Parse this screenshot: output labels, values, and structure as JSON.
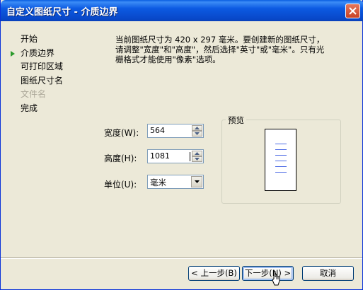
{
  "window": {
    "title": "自定义图纸尺寸 - 介质边界"
  },
  "nav": {
    "items": [
      {
        "label": "开始",
        "current": false,
        "disabled": false
      },
      {
        "label": "介质边界",
        "current": true,
        "disabled": false
      },
      {
        "label": "可打印区域",
        "current": false,
        "disabled": false
      },
      {
        "label": "图纸尺寸名",
        "current": false,
        "disabled": false
      },
      {
        "label": "文件名",
        "current": false,
        "disabled": true
      },
      {
        "label": "完成",
        "current": false,
        "disabled": false
      }
    ]
  },
  "description": {
    "line1": "当前图纸尺寸为 420 x 297 毫米。要创建新的图纸尺寸，",
    "line2": "请调整\"宽度\"和\"高度\"，然后选择\"英寸\"或\"毫米\"。只有光",
    "line3": "栅格式才能使用\"像素\"选项。"
  },
  "form": {
    "width_label": "宽度(W):",
    "width_value": "564",
    "height_label": "高度(H):",
    "height_value": "1081",
    "unit_label": "单位(U):",
    "unit_value": "毫米"
  },
  "preview": {
    "label": "预览"
  },
  "buttons": {
    "back": "< 上一步(B)",
    "next": "下一步(N) >",
    "cancel": "取消"
  },
  "colors": {
    "titlebar": "#0a5fe2",
    "dialog_bg": "#ece9d8",
    "nav_arrow": "#2b9a2b",
    "preview_lines": "#4f6de5"
  }
}
